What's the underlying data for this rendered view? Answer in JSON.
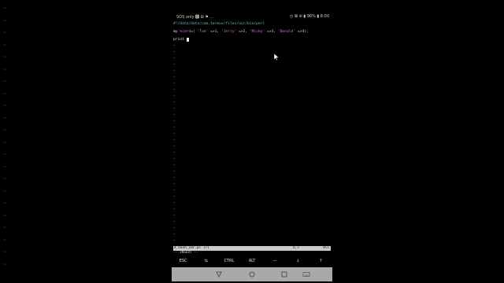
{
  "statusbar": {
    "left_text": "SOS only 🅱 ⊞ ⚑ ...",
    "right_text": "◷ ⊠ ⊛ ▮ 96% ▮ 8:00"
  },
  "editor": {
    "shebang": "#!/data/data/com.termux/files/usr/bin/perl",
    "line2": {
      "kw": "my ",
      "var": "%card",
      "rest1": "=( ",
      "s1": "'Tom'",
      "a1": " =>1, ",
      "s2": "'Jerry'",
      "a2": " =>2, ",
      "s3": "'Micky'",
      "a3": " =>3, ",
      "s4": "'Donald'",
      "a4": " =>4);"
    },
    "line3": {
      "kw": "print "
    },
    "tilde_char": "~"
  },
  "vim_status": {
    "filename": "4_hash_var.pl [+]",
    "position": "5,7",
    "percent": "All",
    "mode": "-- INSERT --"
  },
  "extra_keys": [
    "ESC",
    "⇆",
    "CTRL",
    "ALT",
    "—",
    "↓",
    "↑"
  ],
  "navbar": {
    "back_icon": "back-triangle-icon",
    "home_icon": "home-circle-icon",
    "recents_icon": "recents-square-icon",
    "keyboard_icon": "keyboard-icon"
  },
  "colors": {
    "status_bar_bg": "#c9c9c9",
    "navbar_bg": "#a9a9a9",
    "string_color": "#e06fe0",
    "tilde_color": "#3a76b0"
  }
}
